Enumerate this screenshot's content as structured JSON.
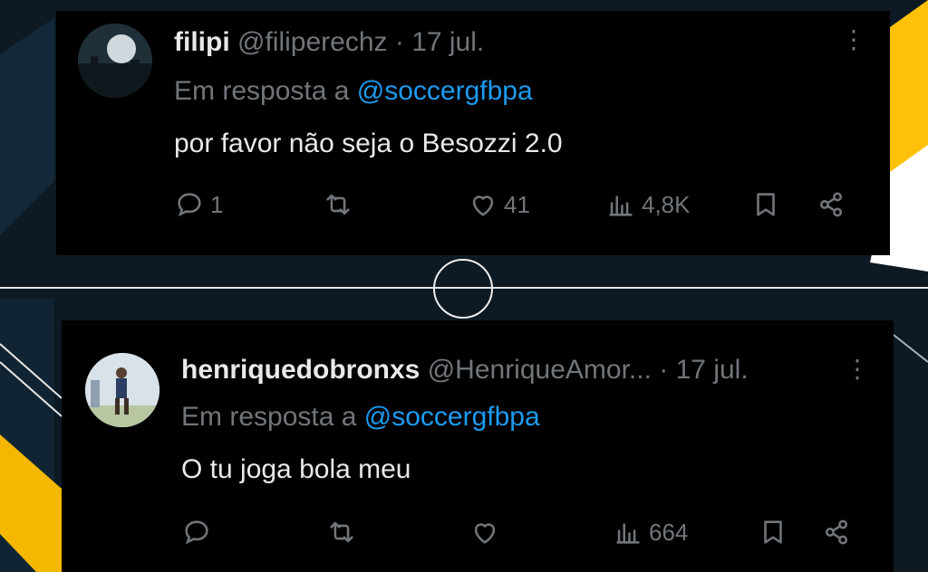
{
  "colors": {
    "tweet_bg": "#000000",
    "text_primary": "#e7e9ea",
    "text_secondary": "#71767b",
    "mention": "#1d9bf0",
    "accent_yellow": "#f5b800"
  },
  "tweets": [
    {
      "display_name": "filipi",
      "handle": "@filiperechz",
      "sep": " · ",
      "date": "17 jul.",
      "reply_prefix": "Em resposta a ",
      "reply_to": "@soccergfbpa",
      "text": "por favor não seja o Besozzi 2.0",
      "replies": "1",
      "retweets": "",
      "likes": "41",
      "views": "4,8K",
      "more": "⋮"
    },
    {
      "display_name": "henriquedobronxs",
      "handle": "@HenriqueAmor...",
      "sep": " · ",
      "date": "17 jul.",
      "reply_prefix": "Em resposta a ",
      "reply_to": "@soccergfbpa",
      "text": "O tu joga bola meu",
      "replies": "",
      "retweets": "",
      "likes": "",
      "views": "664",
      "more": "⋮"
    }
  ]
}
